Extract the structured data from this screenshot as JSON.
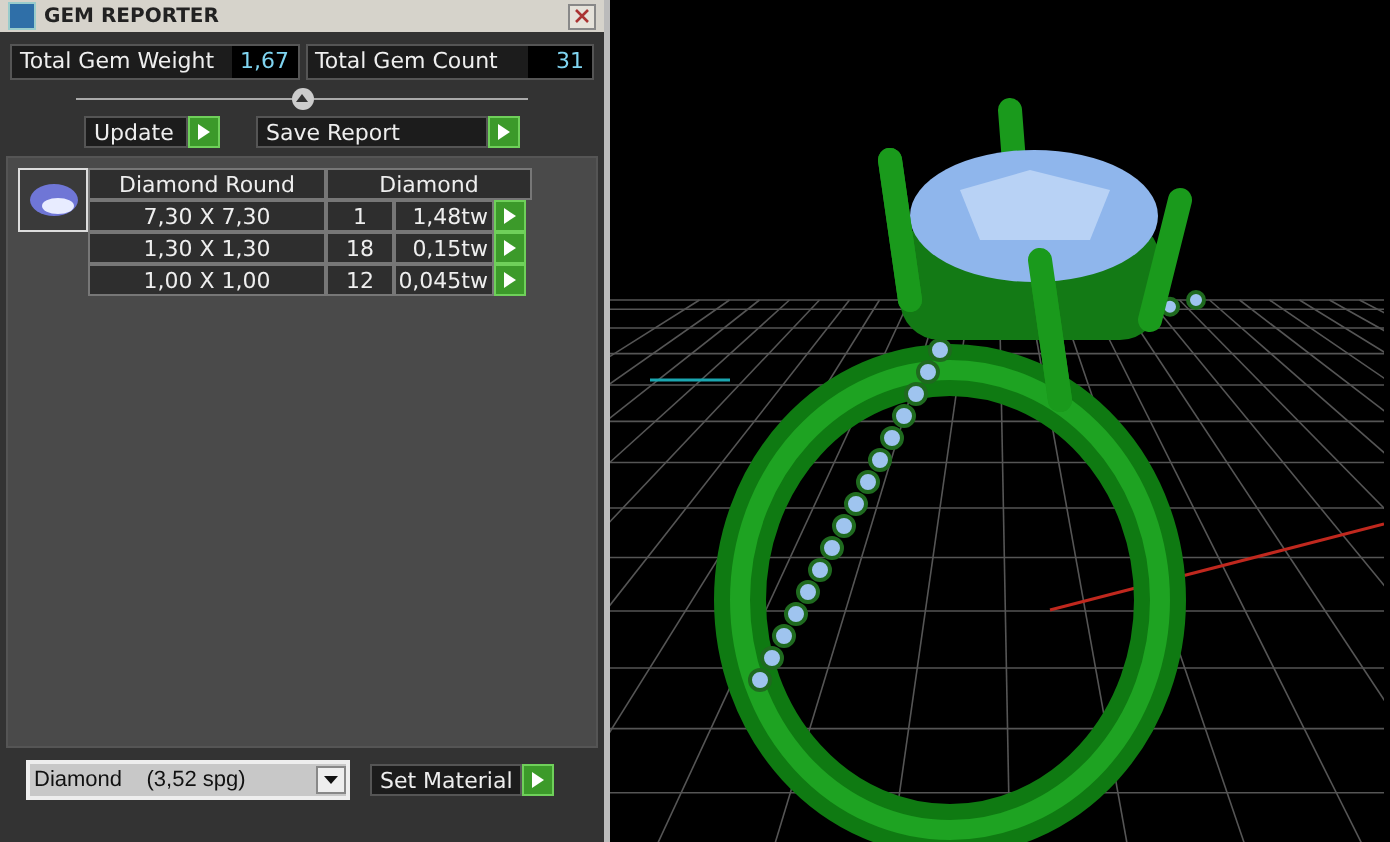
{
  "window": {
    "title": "GEM REPORTER"
  },
  "totals": [
    {
      "label": "Total Gem Weight",
      "value": "1,67"
    },
    {
      "label": "Total Gem Count",
      "value": "31"
    }
  ],
  "buttons": [
    {
      "label": "Update"
    },
    {
      "label": "Save Report"
    }
  ],
  "table": {
    "columns": [
      "Diamond Round",
      "Diamond"
    ],
    "rows": [
      {
        "size": "7,30 X 7,30",
        "count": "1",
        "weight": "1,48tw"
      },
      {
        "size": "1,30 X 1,30",
        "count": "18",
        "weight": "0,15tw"
      },
      {
        "size": "1,00 X 1,00",
        "count": "12",
        "weight": "0,045tw"
      }
    ]
  },
  "material": {
    "value": "Diamond    (3,52 spg)",
    "button": "Set Material"
  }
}
